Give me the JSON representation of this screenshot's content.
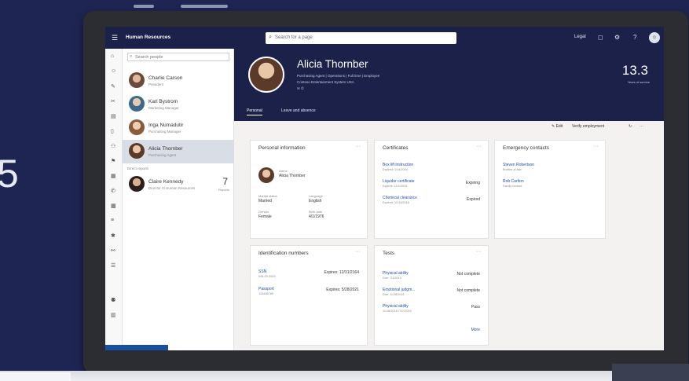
{
  "app": {
    "name": "Human Resources",
    "search_placeholder": "Search for a page",
    "legal": "Legal"
  },
  "people_search": "Search people",
  "people": [
    {
      "name": "Charlie Carson",
      "title": "President"
    },
    {
      "name": "Karl Bystrom",
      "title": "Marketing Manager"
    },
    {
      "name": "Inga Numadutir",
      "title": "Purchasing Manager"
    },
    {
      "name": "Alicia Thornber",
      "title": "Purchasing Agent"
    }
  ],
  "reports_label": "Direct reports",
  "report": {
    "name": "Claire Kennedy",
    "title": "Director of Human Resources",
    "count": "7",
    "count_label": "Reports"
  },
  "employee": {
    "name": "Alicia Thornber",
    "meta": "Purchasing Agent  |  Operations  |  Full time  |  Employee",
    "meta2": "Contoso Entertainment System USA",
    "meta3": "✉  ✆",
    "years": "13.3",
    "years_label": "Years of service"
  },
  "tabs": [
    "Personal",
    "Leave and absence"
  ],
  "actions": {
    "edit": "✎ Edit",
    "verify": "Verify employment"
  },
  "personal": {
    "title": "Personal information",
    "name_label": "Name",
    "name_value": "Alicia Thornber",
    "marital_label": "Marital status",
    "marital_value": "Married",
    "language_label": "Language",
    "language_value": "English",
    "gender_label": "Gender",
    "gender_value": "Female",
    "birth_label": "Birth date",
    "birth_value": "4/1/1976"
  },
  "certificates": {
    "title": "Certificates",
    "items": [
      {
        "link": "Box lift instruction",
        "sub": "Expired: 1/14/2004",
        "status": ""
      },
      {
        "link": "Liquidor certificate",
        "sub": "Expires: 11/1/2019",
        "status": "Expiring"
      },
      {
        "link": "Chemical clearance",
        "sub": "Expired: 11/13/2018",
        "status": "Expired"
      }
    ]
  },
  "emergency": {
    "title": "Emergency contacts",
    "items": [
      {
        "link": "Steven Robertson",
        "sub": "Brother-in-law"
      },
      {
        "link": "Rob Carlton",
        "sub": "Family contact"
      }
    ]
  },
  "identification": {
    "title": "Identification numbers",
    "items": [
      {
        "link": "SSN",
        "sub": "098-20-3003",
        "value": "Expires: 12/31/2164"
      },
      {
        "link": "Passport",
        "sub": "123456789",
        "value": "Expires: 5/28/2021"
      }
    ]
  },
  "tests": {
    "title": "Tests",
    "items": [
      {
        "link": "Physical ability",
        "sub": "Due: 7/1/2019",
        "status": "Not complete"
      },
      {
        "link": "Emotional judgm...",
        "sub": "Due: 11/28/2021",
        "status": "Not complete"
      },
      {
        "link": "Physical ability",
        "sub": "11/18/2018 7/17/2019",
        "status": "Pass"
      }
    ],
    "more": "More"
  }
}
